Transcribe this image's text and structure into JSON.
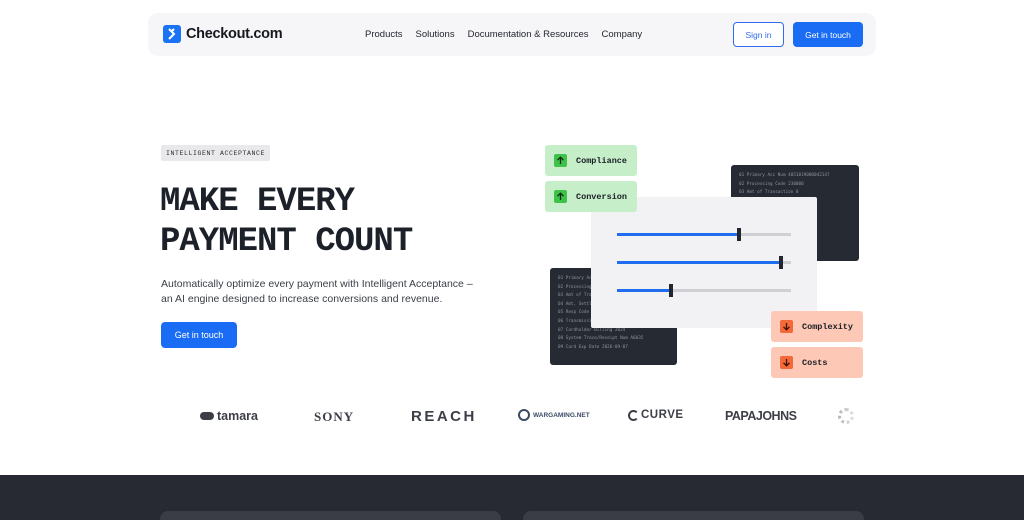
{
  "header": {
    "brand": "Checkout.com",
    "nav": [
      "Products",
      "Solutions",
      "Documentation & Resources",
      "Company"
    ],
    "sign_in": "Sign in",
    "cta": "Get in touch",
    "accent": "#1a6cf5"
  },
  "hero": {
    "eyebrow": "INTELLIGENT ACCEPTANCE",
    "headline": [
      "MAKE EVERY",
      "PAYMENT COUNT"
    ],
    "subtext": "Automatically optimize every payment with Intelligent Acceptance – an AI engine designed to increase conversions and revenue.",
    "cta": "Get in touch"
  },
  "illustration": {
    "up_pills": [
      "Compliance",
      "Conversion"
    ],
    "down_pills": [
      "Complexity",
      "Costs"
    ],
    "sliders": [
      0.7,
      0.94,
      0.31
    ],
    "green": "#3ec24a",
    "orange": "#f3693a"
  },
  "logos": [
    "tamara",
    "SONY",
    "REACH",
    "WARGAMING.NET",
    "CURVE",
    "PAPAJOHNS"
  ]
}
